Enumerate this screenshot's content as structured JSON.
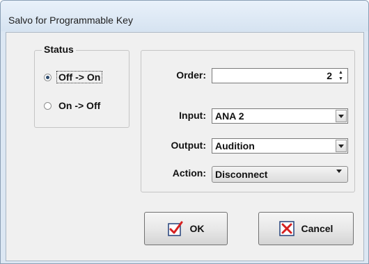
{
  "window": {
    "title": "Salvo for Programmable Key"
  },
  "status": {
    "legend": "Status",
    "options": [
      {
        "label": "Off -> On",
        "selected": true
      },
      {
        "label": "On -> Off",
        "selected": false
      }
    ]
  },
  "fields": {
    "order": {
      "label": "Order:",
      "value": "2"
    },
    "input": {
      "label": "Input:",
      "value": "ANA 2"
    },
    "output": {
      "label": "Output:",
      "value": "Audition"
    },
    "action": {
      "label": "Action:",
      "value": "Disconnect"
    }
  },
  "buttons": {
    "ok": {
      "label": "OK",
      "icon": "checkmark-icon",
      "icon_color": "#d62020"
    },
    "cancel": {
      "label": "Cancel",
      "icon": "x-icon",
      "icon_color": "#d62020"
    }
  },
  "colors": {
    "accent": "#2c4a6d",
    "titlebar": "#dce7f3"
  }
}
